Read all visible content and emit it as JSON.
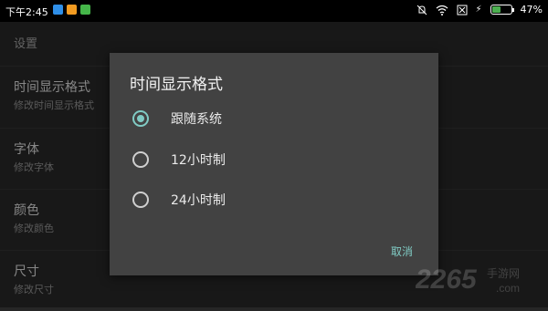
{
  "status_bar": {
    "time": "下午2:45",
    "battery_text": "47%",
    "battery_level": 0.47,
    "colors": {
      "battery_fill": "#4caf50"
    },
    "app_icons": [
      {
        "name": "app-notification-icon-1",
        "color": "#2f8fe8"
      },
      {
        "name": "app-notification-icon-2",
        "color": "#f29b21"
      },
      {
        "name": "app-notification-icon-3",
        "color": "#45b649"
      }
    ]
  },
  "page": {
    "title": "设置",
    "rows": [
      {
        "title": "时间显示格式",
        "subtitle": "修改时间显示格式"
      },
      {
        "title": "字体",
        "subtitle": "修改字体"
      },
      {
        "title": "颜色",
        "subtitle": "修改颜色"
      },
      {
        "title": "尺寸",
        "subtitle": "修改尺寸"
      }
    ]
  },
  "dialog": {
    "title": "时间显示格式",
    "options": [
      {
        "label": "跟随系统",
        "checked": true
      },
      {
        "label": "12小时制",
        "checked": false
      },
      {
        "label": "24小时制",
        "checked": false
      }
    ],
    "cancel": "取消",
    "accent_color": "#80cbc4"
  },
  "watermark": {
    "text": "2265",
    "suffix": "手游网",
    "domain": ".com"
  }
}
